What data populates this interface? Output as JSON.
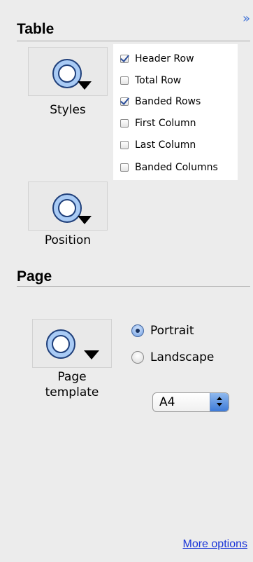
{
  "expand_glyph": "»",
  "table": {
    "title": "Table",
    "styles_caption": "Styles",
    "position_caption": "Position",
    "options": [
      {
        "label": "Header Row",
        "checked": true
      },
      {
        "label": "Total Row",
        "checked": false
      },
      {
        "label": "Banded Rows",
        "checked": true
      },
      {
        "label": "First Column",
        "checked": false
      },
      {
        "label": "Last Column",
        "checked": false
      },
      {
        "label": "Banded Columns",
        "checked": false
      }
    ]
  },
  "page": {
    "title": "Page",
    "template_caption_line1": "Page",
    "template_caption_line2": "template",
    "orientation": [
      {
        "label": "Portrait",
        "selected": true
      },
      {
        "label": "Landscape",
        "selected": false
      }
    ],
    "paper_size": "A4"
  },
  "more_options": "More options",
  "colors": {
    "circle_fill": "#a9cbf5",
    "circle_stroke": "#1f3f7a",
    "link": "#1a35d8"
  },
  "icons": {
    "style_tile": "circle-with-dropdown-triangle-icon",
    "expand": "double-chevron-right-icon"
  }
}
